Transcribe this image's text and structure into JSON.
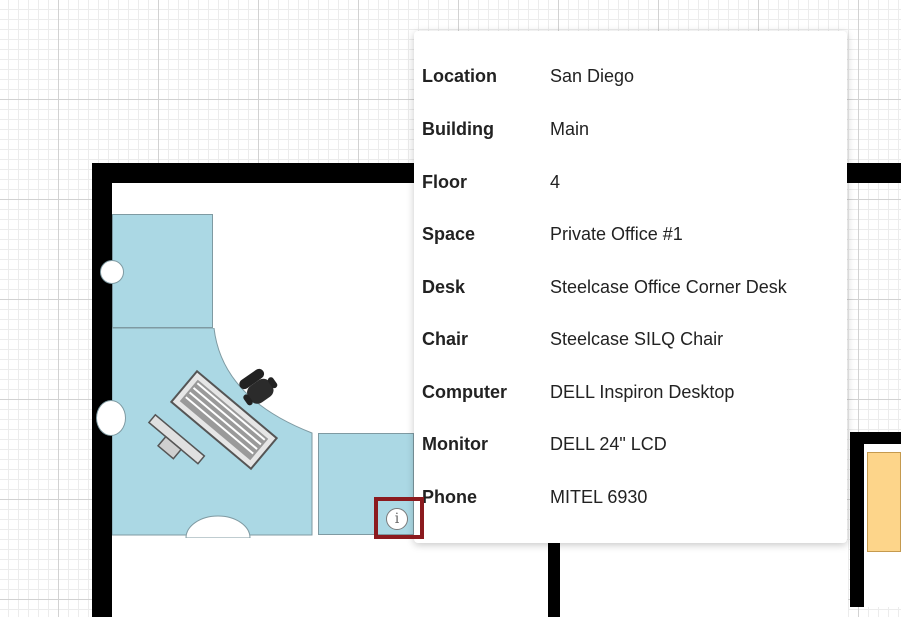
{
  "tooltip": {
    "rows": [
      {
        "label": "Location",
        "value": "San Diego"
      },
      {
        "label": "Building",
        "value": "Main"
      },
      {
        "label": "Floor",
        "value": "4"
      },
      {
        "label": "Space",
        "value": "Private Office #1"
      },
      {
        "label": "Desk",
        "value": "Steelcase Office Corner Desk"
      },
      {
        "label": "Chair",
        "value": "Steelcase SILQ Chair"
      },
      {
        "label": "Computer",
        "value": "DELL Inspiron Desktop"
      },
      {
        "label": "Monitor",
        "value": "DELL 24\" LCD"
      },
      {
        "label": "Phone",
        "value": "MITEL 6930"
      }
    ]
  },
  "info_button": {
    "icon": "info-icon",
    "glyph": "i",
    "highlight_color": "#8b1a1e"
  },
  "colors": {
    "desk": "#abd8e4",
    "adjacent_room": "#fdd58a",
    "wall": "#000000"
  }
}
